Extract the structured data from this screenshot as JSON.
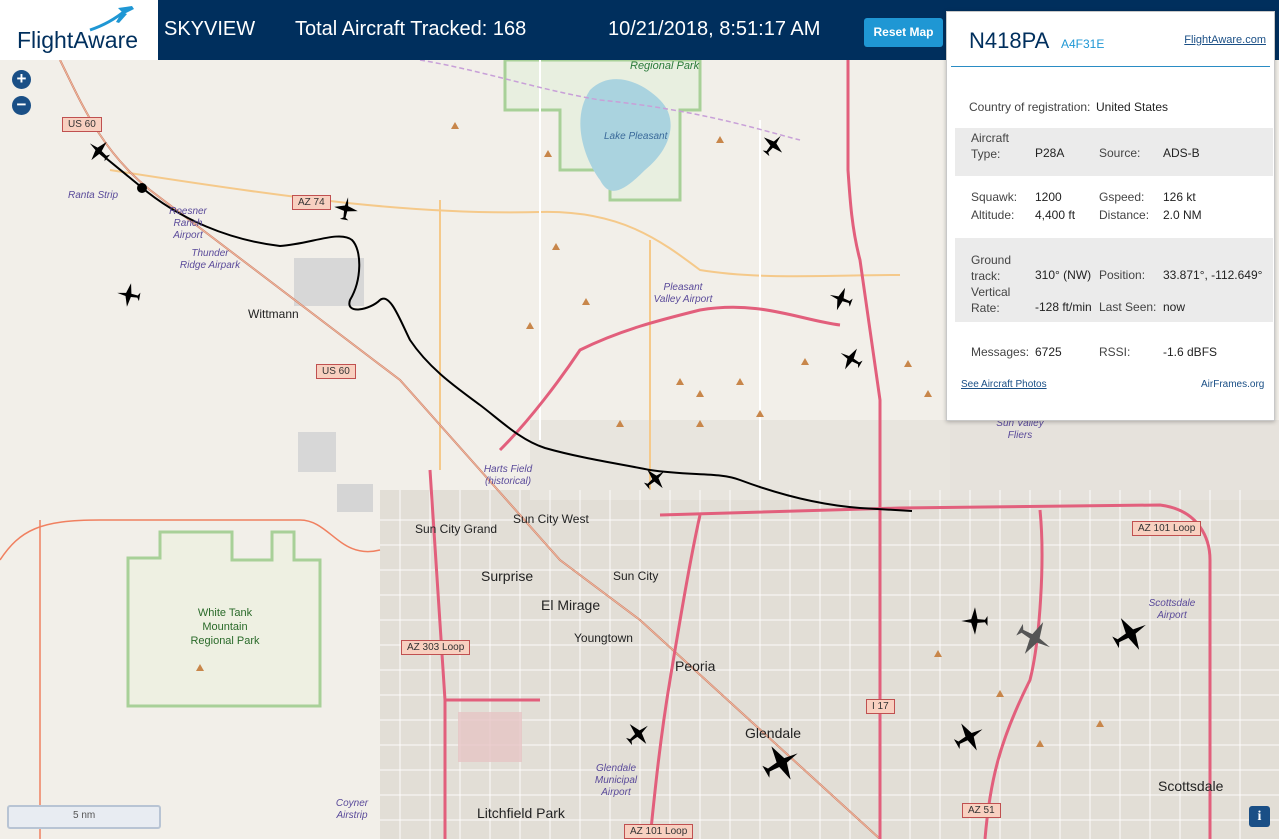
{
  "header": {
    "brand": "FlightAware",
    "app_title": "SKYVIEW",
    "tracked": "Total Aircraft Tracked: 168",
    "datetime": "10/21/2018, 8:51:17 AM",
    "reset_label": "Reset Map"
  },
  "map": {
    "zoom_in": "+",
    "zoom_out": "−",
    "scale_label": "5 nm",
    "info_label": "i",
    "towns": [
      "Wittmann",
      "Sun City Grand",
      "Sun City West",
      "Surprise",
      "El Mirage",
      "Sun City",
      "Youngtown",
      "Peoria",
      "Glendale",
      "Litchfield Park",
      "Scottsdale"
    ],
    "places": [
      "Ranta Strip",
      "Roesner Ranch Airport",
      "Thunder Ridge Airpark",
      "Pleasant Valley Airport",
      "Harts Field (historical)",
      "Glendale Municipal Airport",
      "Coyner Airstrip",
      "Scottsdale Airport",
      "Sun Valley Fliers",
      "Lake Pleasant",
      "Regional Park",
      "White Tank Mountain Regional Park"
    ],
    "highways": [
      "US 60",
      "AZ 74",
      "US 60",
      "AZ 101 Loop",
      "AZ 303 Loop",
      "I 17",
      "AZ 51",
      "AZ 101 Loop"
    ]
  },
  "aircraft": {
    "registration": "N418PA",
    "icao_hex": "A4F31E",
    "link_flightaware": "FlightAware.com",
    "country_label": "Country of registration:",
    "country_value": "United States",
    "aircraft_type_label": "Aircraft Type:",
    "aircraft_type_value": "P28A",
    "source_label": "Source:",
    "source_value": "ADS-B",
    "squawk_label": "Squawk:",
    "squawk_value": "1200",
    "gspeed_label": "Gspeed:",
    "gspeed_value": "126 kt",
    "altitude_label": "Altitude:",
    "altitude_value": "4,400 ft",
    "distance_label": "Distance:",
    "distance_value": "2.0 NM",
    "ground_track_label": "Ground track:",
    "ground_track_value": "310° (NW)",
    "position_label": "Position:",
    "position_value": "33.871°, -112.649°",
    "vertical_rate_label": "Vertical Rate:",
    "vertical_rate_value": "-128 ft/min",
    "last_seen_label": "Last Seen:",
    "last_seen_value": "now",
    "messages_label": "Messages:",
    "messages_value": "6725",
    "rssi_label": "RSSI:",
    "rssi_value": "-1.6 dBFS",
    "photos_link": "See Aircraft Photos",
    "airframes_link": "AirFrames.org"
  }
}
